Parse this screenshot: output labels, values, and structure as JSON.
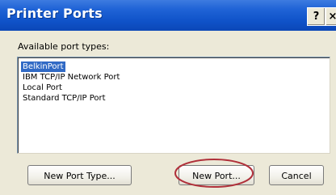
{
  "window": {
    "title": "Printer Ports",
    "help_glyph": "?",
    "close_glyph": "×"
  },
  "content": {
    "label": "Available port types:",
    "port_types": [
      "BelkinPort",
      "IBM TCP/IP Network Port",
      "Local Port",
      "Standard TCP/IP Port"
    ],
    "selected_index": 0
  },
  "buttons": {
    "new_port_type": "New Port Type...",
    "new_port": "New Port...",
    "cancel": "Cancel"
  },
  "colors": {
    "titlebar": "#0f52c8",
    "selection": "#316ac5",
    "annotation_circle": "#b0303a"
  }
}
